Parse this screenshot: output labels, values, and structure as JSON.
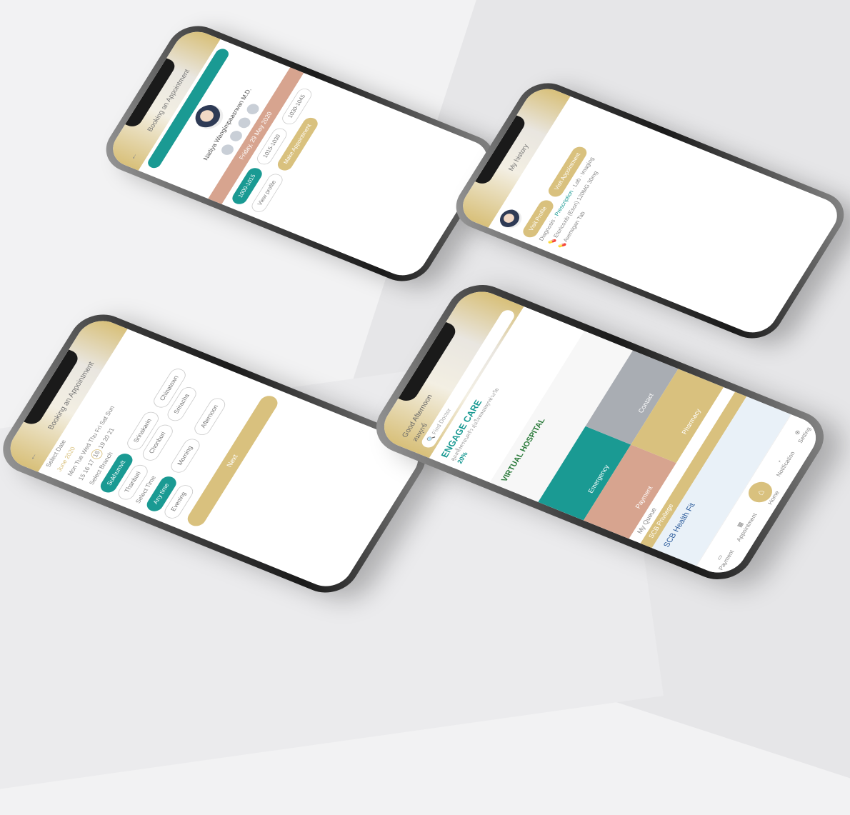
{
  "booking_doctor": {
    "title": "Booking an Appointment",
    "doctor_name": "Nadiya Wangimpaasrwan M.D.",
    "date": "Friday, 29 May 2020",
    "slots": [
      "1000-1015",
      "1015-1030",
      "1030-1045",
      "10"
    ],
    "view_profile": "View profile",
    "make_appointment": "Make Appointment"
  },
  "history": {
    "title": "My history",
    "tabs": [
      "Visit Profile",
      "Visit Appointment"
    ],
    "subtabs": [
      "Diagnosis",
      "Prescription",
      "Lab",
      "Imaging"
    ],
    "medicines": [
      "Etoricoxib (Esori) 120MG 30mg",
      "Avemigan Tab"
    ]
  },
  "booking_filter": {
    "title": "Booking an Appointment",
    "select_date": "Select Date",
    "month": "June 2020",
    "days": [
      "Mon",
      "Tue",
      "Wed",
      "Thu",
      "Fri",
      "Sat",
      "Sun"
    ],
    "dates": [
      "15",
      "16",
      "17",
      "18",
      "19",
      "20",
      "21"
    ],
    "select_branch": "Select Branch",
    "branches": [
      "Sukhumvit",
      "Srinakarin",
      "Chinatown",
      "Thanburi",
      "Chonburi",
      "Sriracha"
    ],
    "select_time": "Select Time",
    "times": [
      "Any time",
      "Morning",
      "Afternoon",
      "Evening"
    ],
    "next": "Next"
  },
  "home": {
    "greeting": "Good Afternoon",
    "user": "สมทุกข์",
    "search_placeholder": "Find Doctor",
    "banner_brand": "ENGAGE CARE",
    "banner_sub": "ดูแลทั้งครอบครัว อุ่นใจตลอดทุกช่วงวัย",
    "banner_discount": "20%",
    "virtual": "VIRTUAL HOSPITAL",
    "date_day": "05",
    "tiles": [
      "Emergency",
      "Contact",
      "Payment",
      "Pharmacy"
    ],
    "queue": "My Queue",
    "privilege": "SCB Privilege",
    "promo": "SCB Health Fit",
    "nav": [
      "Payment",
      "Appointment",
      "Home",
      "Notification",
      "Setting"
    ]
  }
}
